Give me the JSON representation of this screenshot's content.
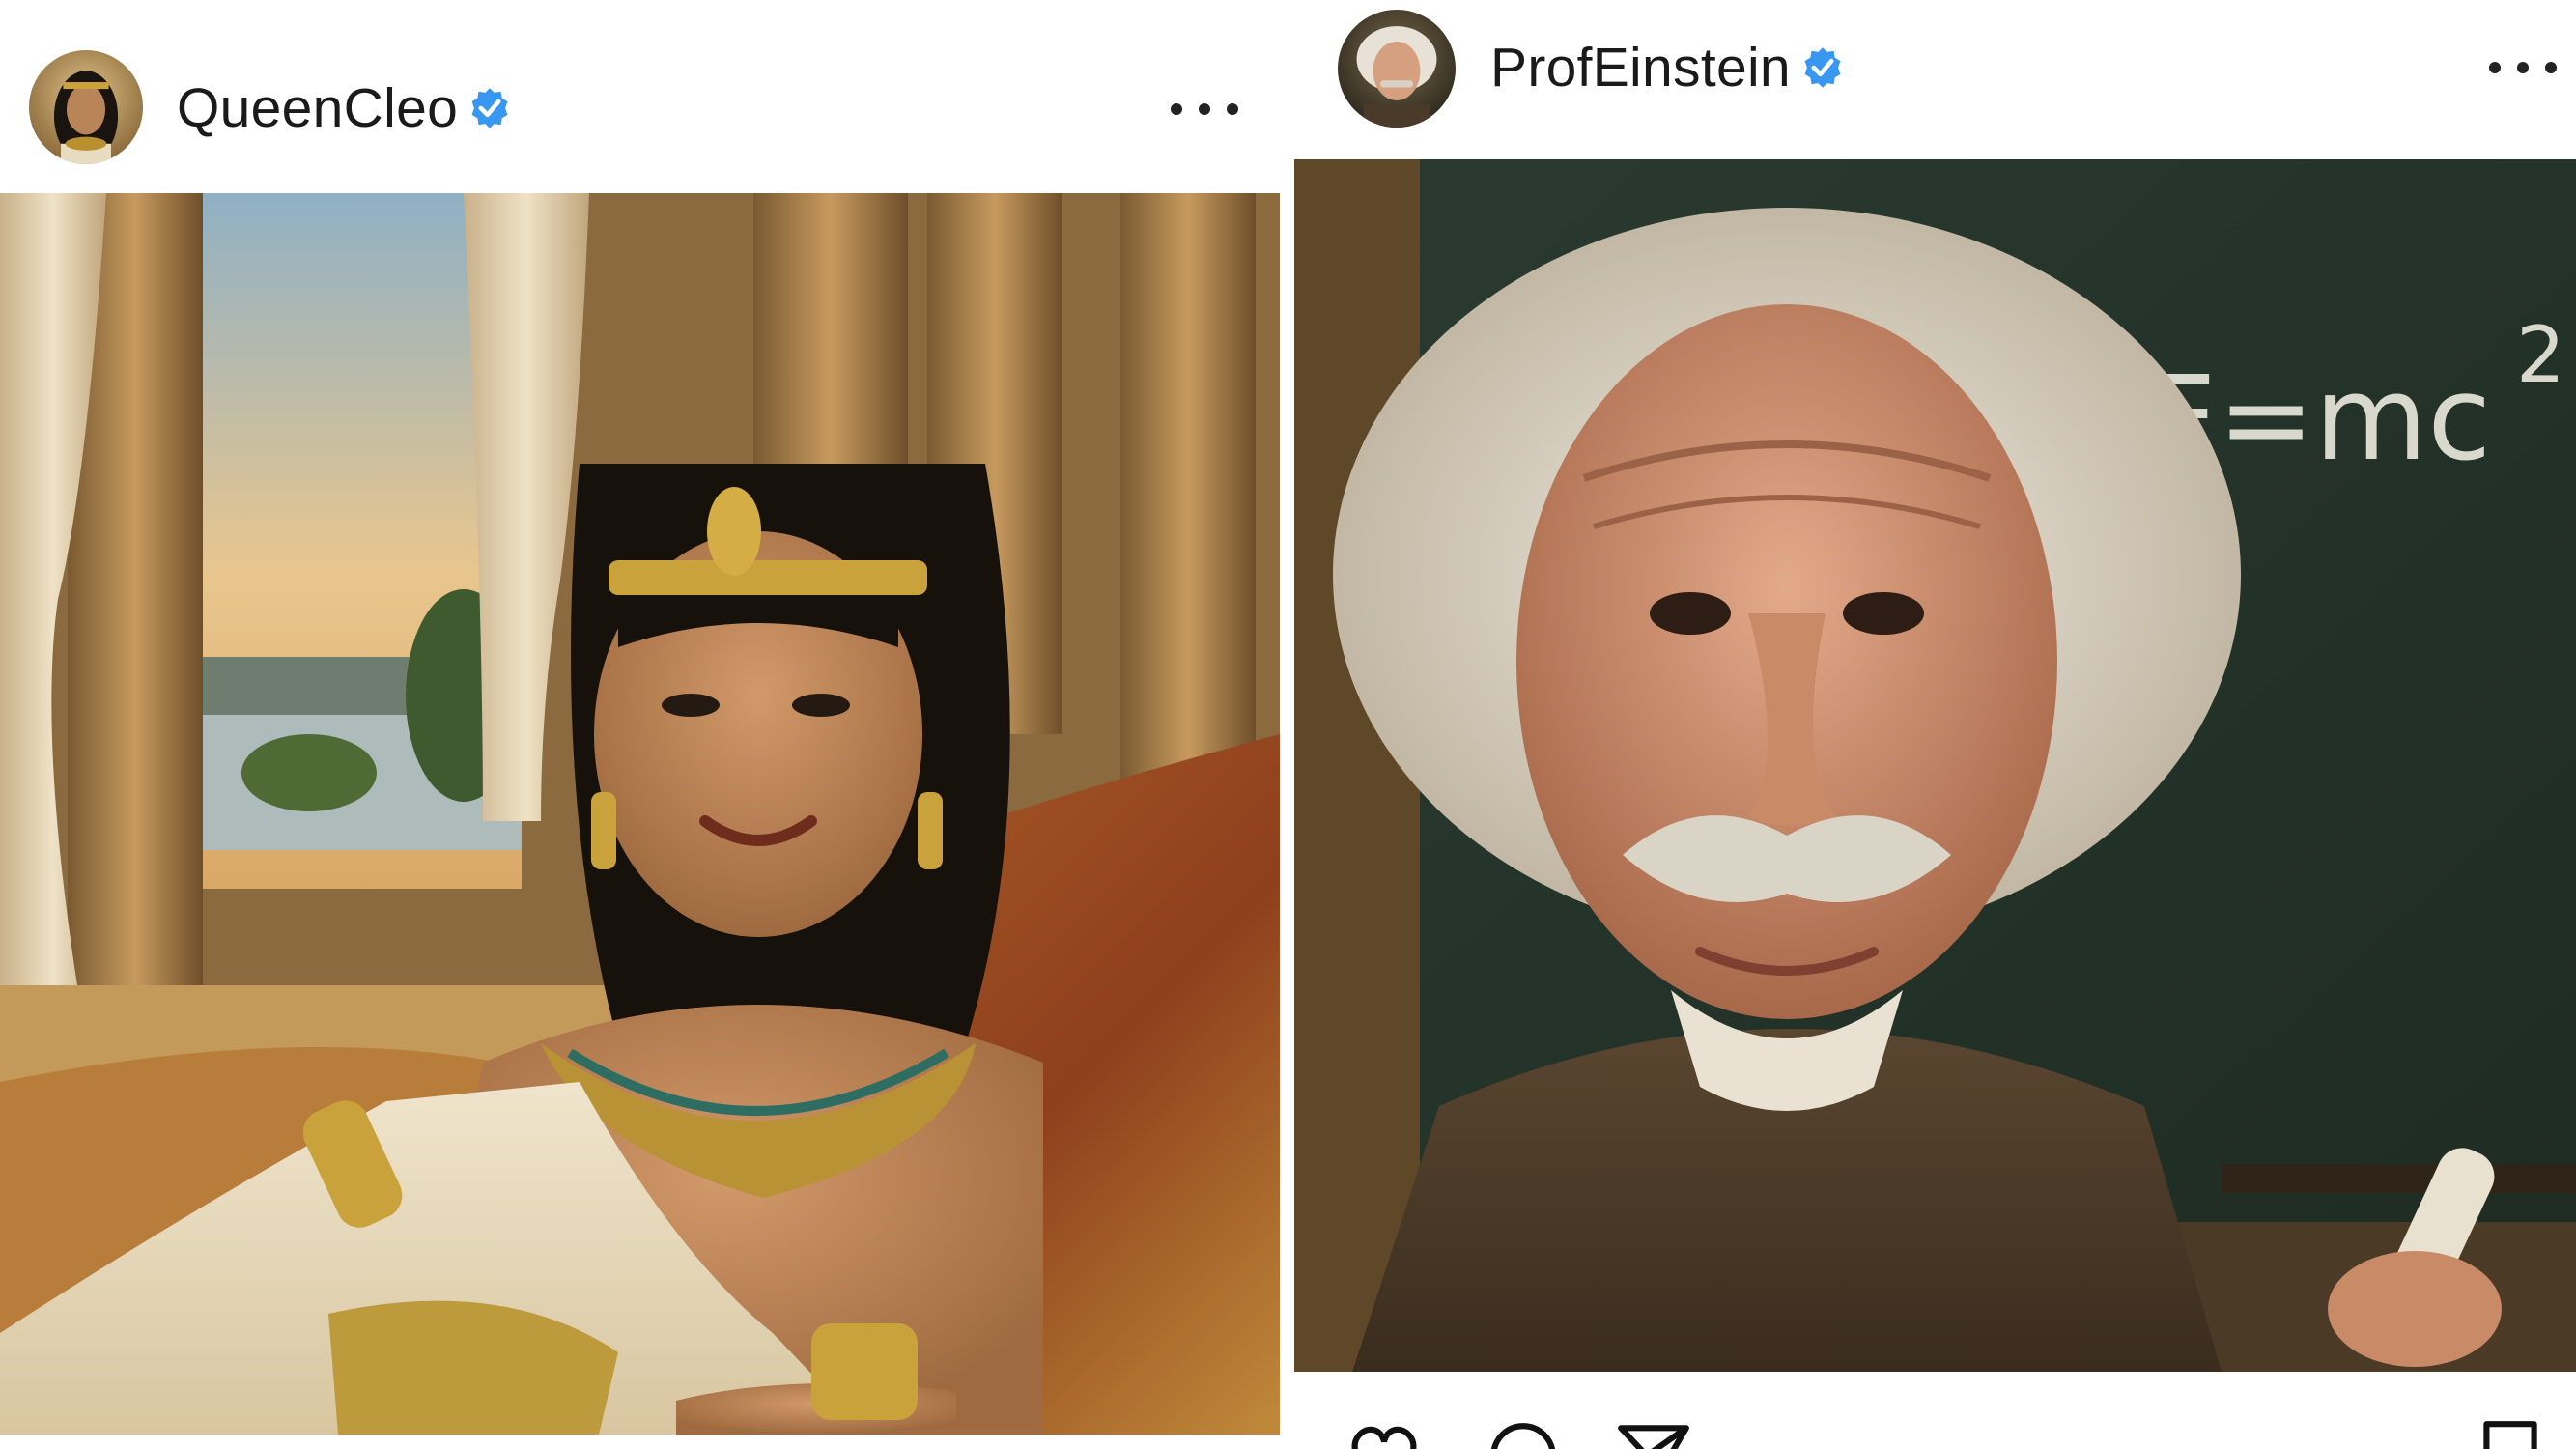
{
  "posts": [
    {
      "username": "QueenCleo",
      "verified": true,
      "more_icon": "more-horizontal-icon",
      "avatar_icon": "avatar",
      "image_alt_subject": "photo"
    },
    {
      "username": "ProfEinstein",
      "verified": true,
      "more_icon": "more-horizontal-icon",
      "avatar_icon": "avatar",
      "chalkboard_text": "E=mc",
      "chalkboard_superscript": "2",
      "actions": [
        "heart-icon",
        "comment-icon",
        "send-icon",
        "bookmark-icon"
      ]
    }
  ],
  "colors": {
    "verified_badge": "#3897f0",
    "text": "#1a1a1a",
    "background": "#ffffff"
  }
}
